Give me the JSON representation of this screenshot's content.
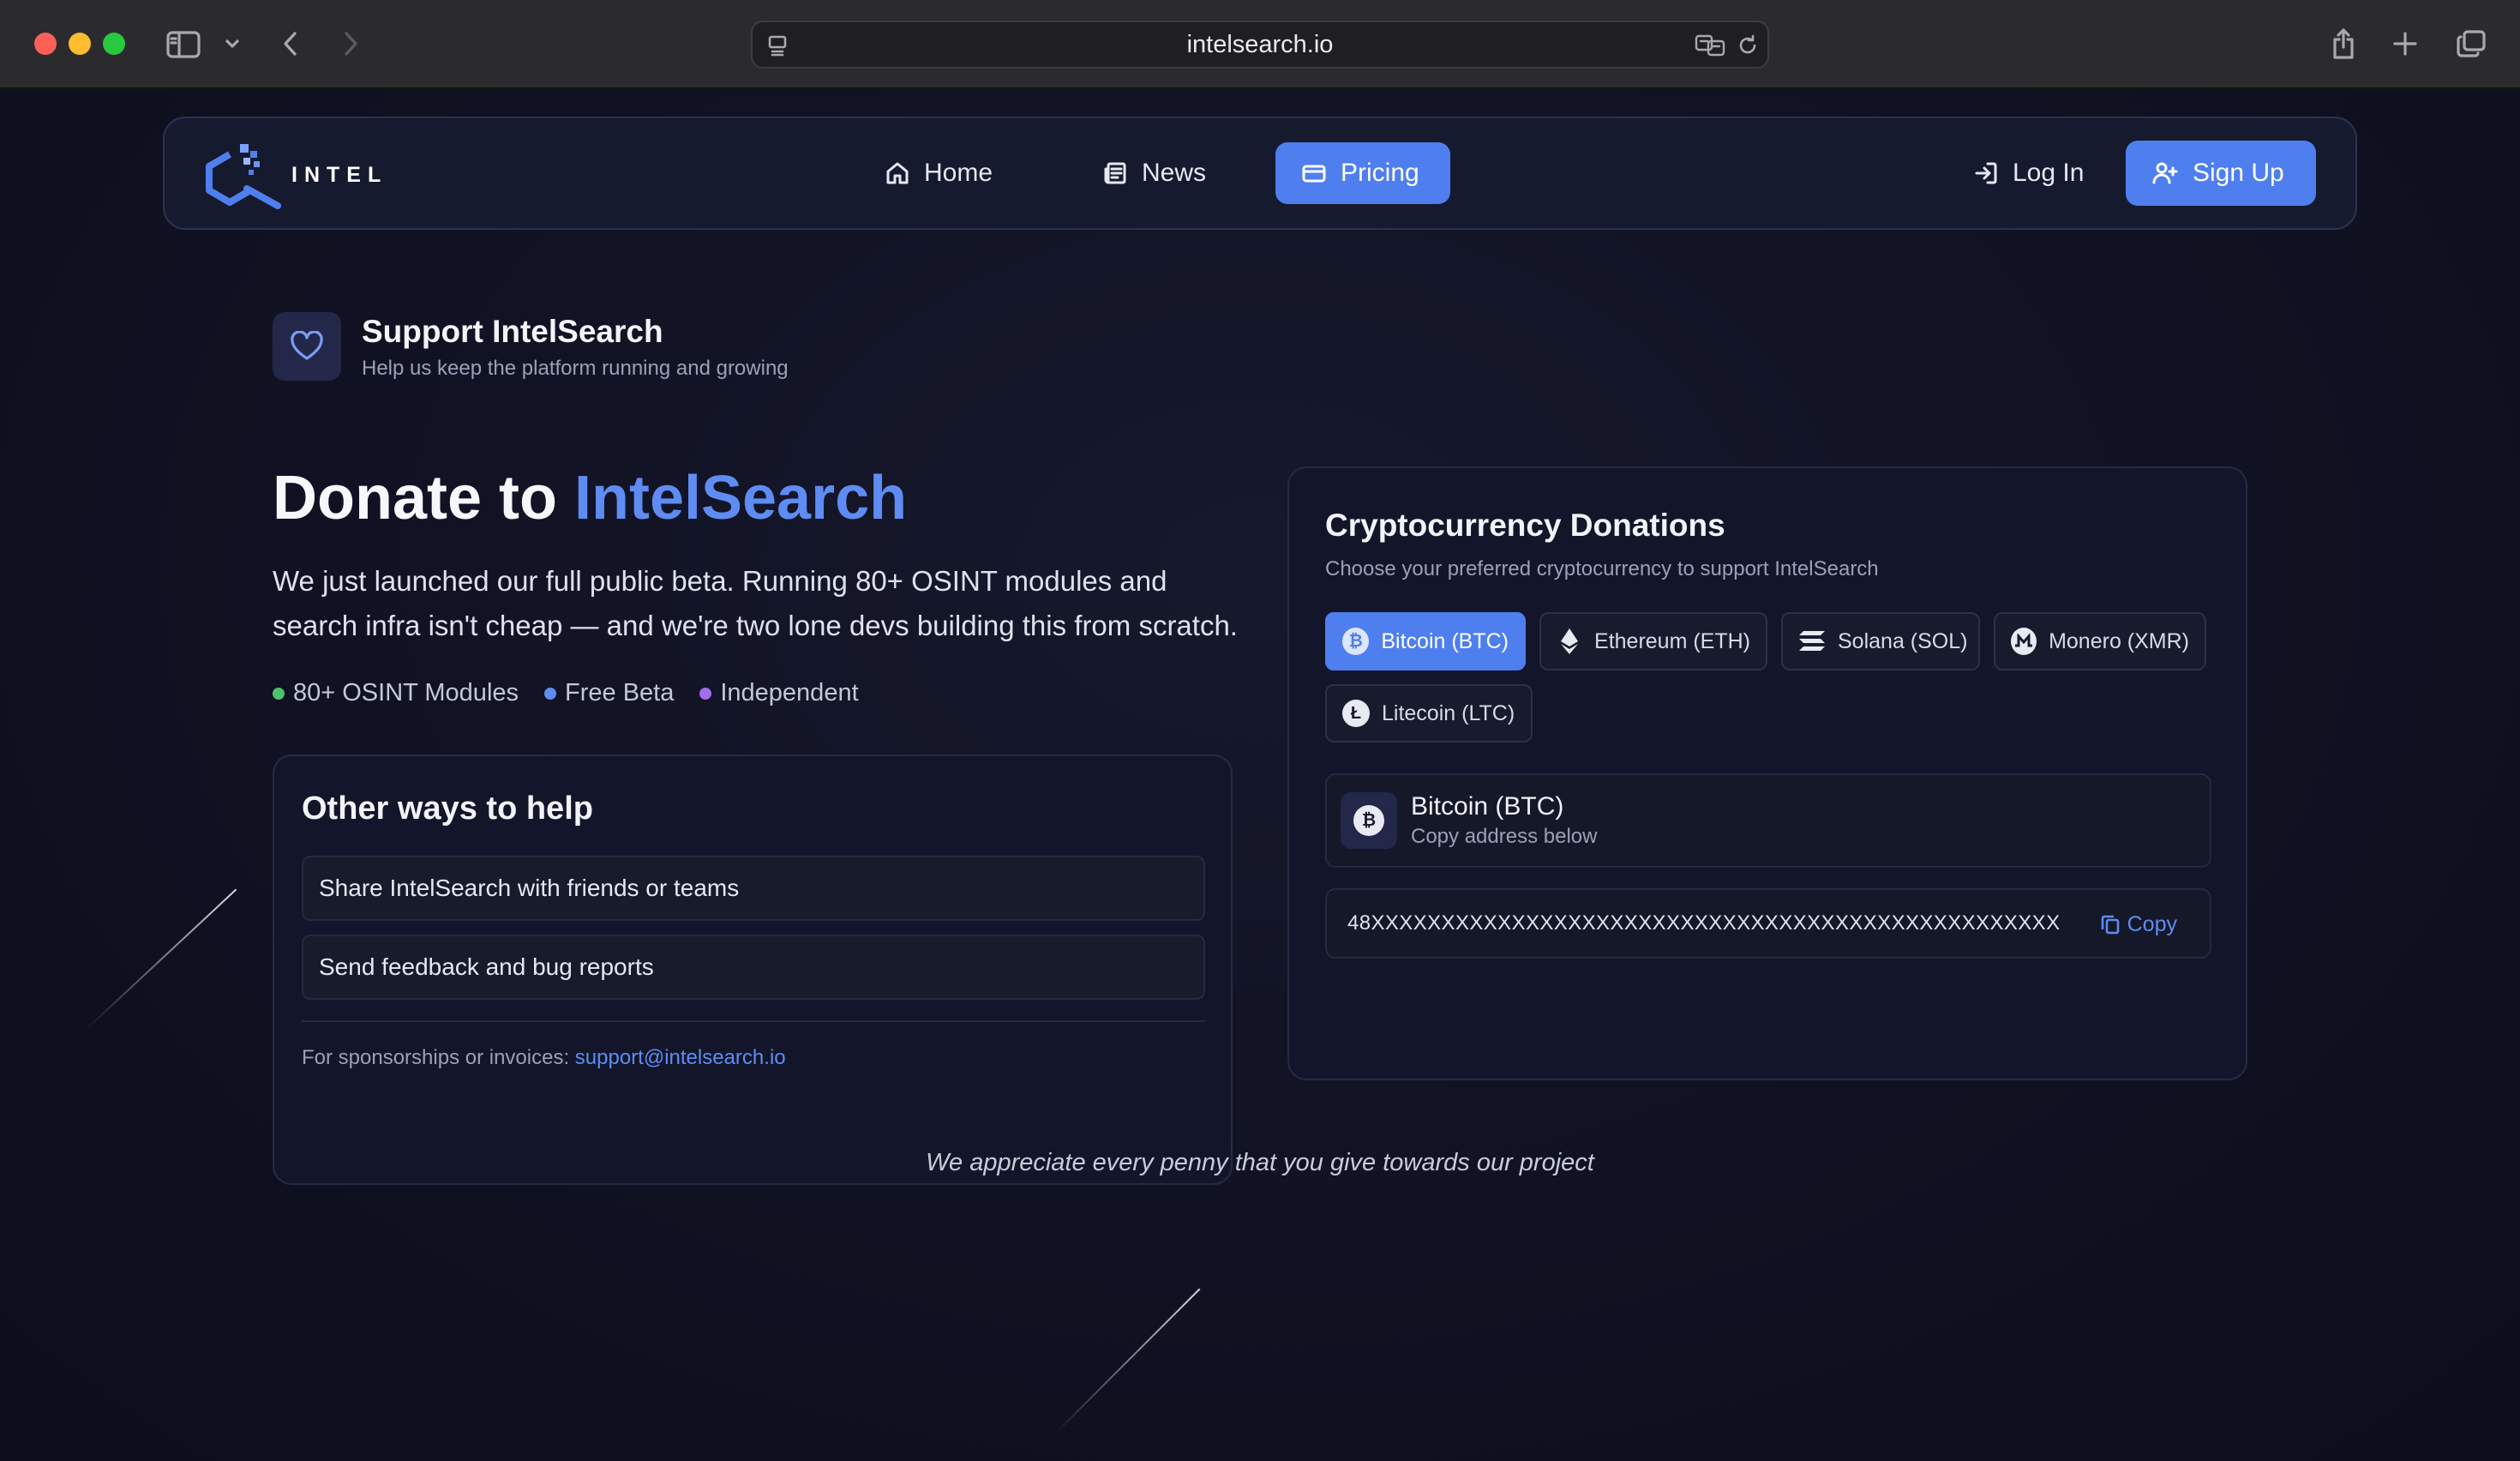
{
  "browser": {
    "url": "intelsearch.io"
  },
  "nav": {
    "logo_text": "INTEL",
    "home": "Home",
    "news": "News",
    "pricing": "Pricing",
    "login": "Log In",
    "signup": "Sign Up"
  },
  "support": {
    "title": "Support IntelSearch",
    "subtitle": "Help us keep the platform running and growing"
  },
  "hero": {
    "title_prefix": "Donate to ",
    "title_accent": "IntelSearch",
    "intro": "We just launched our full public beta. Running 80+ OSINT modules and search infra isn't cheap — and we're two lone devs building this from scratch.",
    "tags": [
      {
        "label": "80+ OSINT Modules",
        "color": "#4cc36a"
      },
      {
        "label": "Free Beta",
        "color": "#5e8cf3"
      },
      {
        "label": "Independent",
        "color": "#a06ee8"
      }
    ]
  },
  "help": {
    "title": "Other ways to help",
    "items": [
      "Share IntelSearch with friends or teams",
      "Send feedback and bug reports"
    ],
    "footer_prefix": "For sponsorships or invoices: ",
    "email": "support@intelsearch.io"
  },
  "crypto": {
    "title": "Cryptocurrency Donations",
    "subtitle": "Choose your preferred cryptocurrency to support IntelSearch",
    "coins": [
      {
        "label": "Bitcoin (BTC)",
        "icon": "bitcoin-icon",
        "active": true
      },
      {
        "label": "Ethereum (ETH)",
        "icon": "ethereum-icon",
        "active": false
      },
      {
        "label": "Solana (SOL)",
        "icon": "solana-icon",
        "active": false
      },
      {
        "label": "Monero (XMR)",
        "icon": "monero-icon",
        "active": false
      },
      {
        "label": "Litecoin (LTC)",
        "icon": "litecoin-icon",
        "active": false
      }
    ],
    "selected": {
      "name": "Bitcoin (BTC)",
      "hint": "Copy address below",
      "address": "48XXXXXXXXXXXXXXXXXXXXXXXXXXXXXXXXXXXXXXXXXXXXXXXXX",
      "copy_label": "Copy"
    }
  },
  "footer": {
    "thanks": "We appreciate every penny that you give towards our project"
  },
  "colors": {
    "accent": "#4f7fee",
    "accent_text": "#5e8cf3",
    "background": "#101223"
  }
}
